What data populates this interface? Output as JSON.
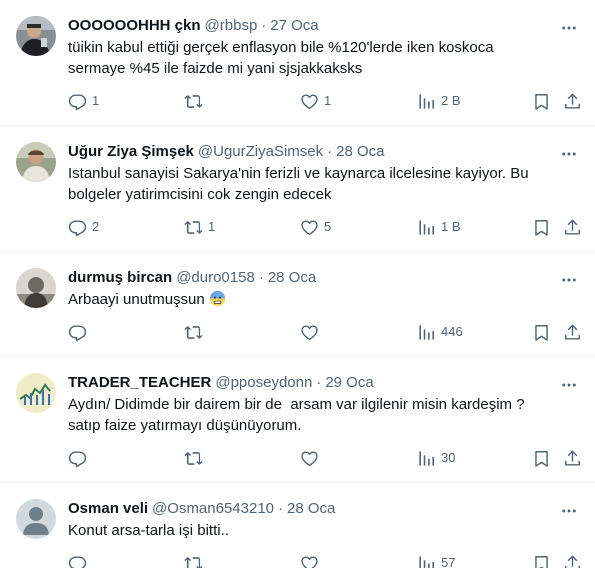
{
  "tweets": [
    {
      "name": "OOOOOOHHH çkn",
      "handle": "@rbbsp",
      "date": "27 Oca",
      "text": "tüikin kabul ettiği gerçek enflasyon bile %120'lerde iken koskoca sermaye %45 ile faizde mi yani sjsjakkaksks",
      "replies": "1",
      "retweets": "",
      "likes": "1",
      "views": "2 B"
    },
    {
      "name": "Uğur Ziya Şimşek",
      "handle": "@UgurZiyaSimsek",
      "date": "28 Oca",
      "text": "Istanbul sanayisi Sakarya'nin ferizli ve kaynarca ilcelesine kayiyor. Bu bolgeler yatirimcisini cok zengin edecek",
      "replies": "2",
      "retweets": "1",
      "likes": "5",
      "views": "1 B"
    },
    {
      "name": "durmuş bircan",
      "handle": "@duro0158",
      "date": "28 Oca",
      "text": "Arbaayi unutmuşsun",
      "emoji": "cold-sweat-face-emoji",
      "replies": "",
      "retweets": "",
      "likes": "",
      "views": "446"
    },
    {
      "name": "TRADER_TEACHER",
      "handle": "@pposeydonn",
      "date": "29 Oca",
      "text": "Aydın/ Didimde bir dairem bir de  arsam var ilgilenir misin kardeşim ? satıp faize yatırmayı düşünüyorum.",
      "replies": "",
      "retweets": "",
      "likes": "",
      "views": "30"
    },
    {
      "name": "Osman veli",
      "handle": "@Osman6543210",
      "date": "28 Oca",
      "text": "Konut arsa-tarla işi bitti..",
      "replies": "",
      "retweets": "",
      "likes": "",
      "views": "57"
    }
  ],
  "separator": "·",
  "colors": {
    "text": "#0f1419",
    "secondary": "#536471",
    "border": "#eff3f4"
  },
  "icons": [
    "more-icon",
    "reply-icon",
    "retweet-icon",
    "like-icon",
    "views-icon",
    "bookmark-icon",
    "share-icon"
  ]
}
